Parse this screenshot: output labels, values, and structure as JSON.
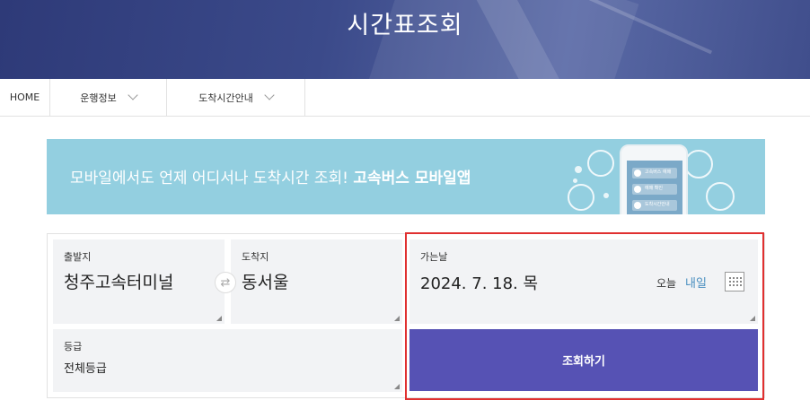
{
  "header": {
    "title": "시간표조회"
  },
  "subnav": {
    "home": "HOME",
    "items": [
      {
        "label": "운행정보"
      },
      {
        "label": "도착시간안내"
      }
    ]
  },
  "banner": {
    "text": "모바일에서도 언제 어디서나 도착시간 조회! ",
    "highlight": "고속버스 모바일앱",
    "phone_rows": [
      "고속버스 예매",
      "예매 확인",
      "도착시간안내"
    ]
  },
  "form": {
    "departure": {
      "label": "출발지",
      "value": "청주고속터미널"
    },
    "arrival": {
      "label": "도착지",
      "value": "동서울"
    },
    "date": {
      "label": "가는날",
      "value": "2024. 7. 18. 목",
      "today": "오늘",
      "tomorrow": "내일"
    },
    "grade": {
      "label": "등급",
      "value": "전체등급"
    },
    "search_button": "조회하기"
  },
  "colors": {
    "header_bg": "#3b4a8a",
    "banner_bg": "#93cfe0",
    "button_bg": "#5652b4",
    "highlight_border": "#e03030",
    "link": "#4a8fc0"
  }
}
